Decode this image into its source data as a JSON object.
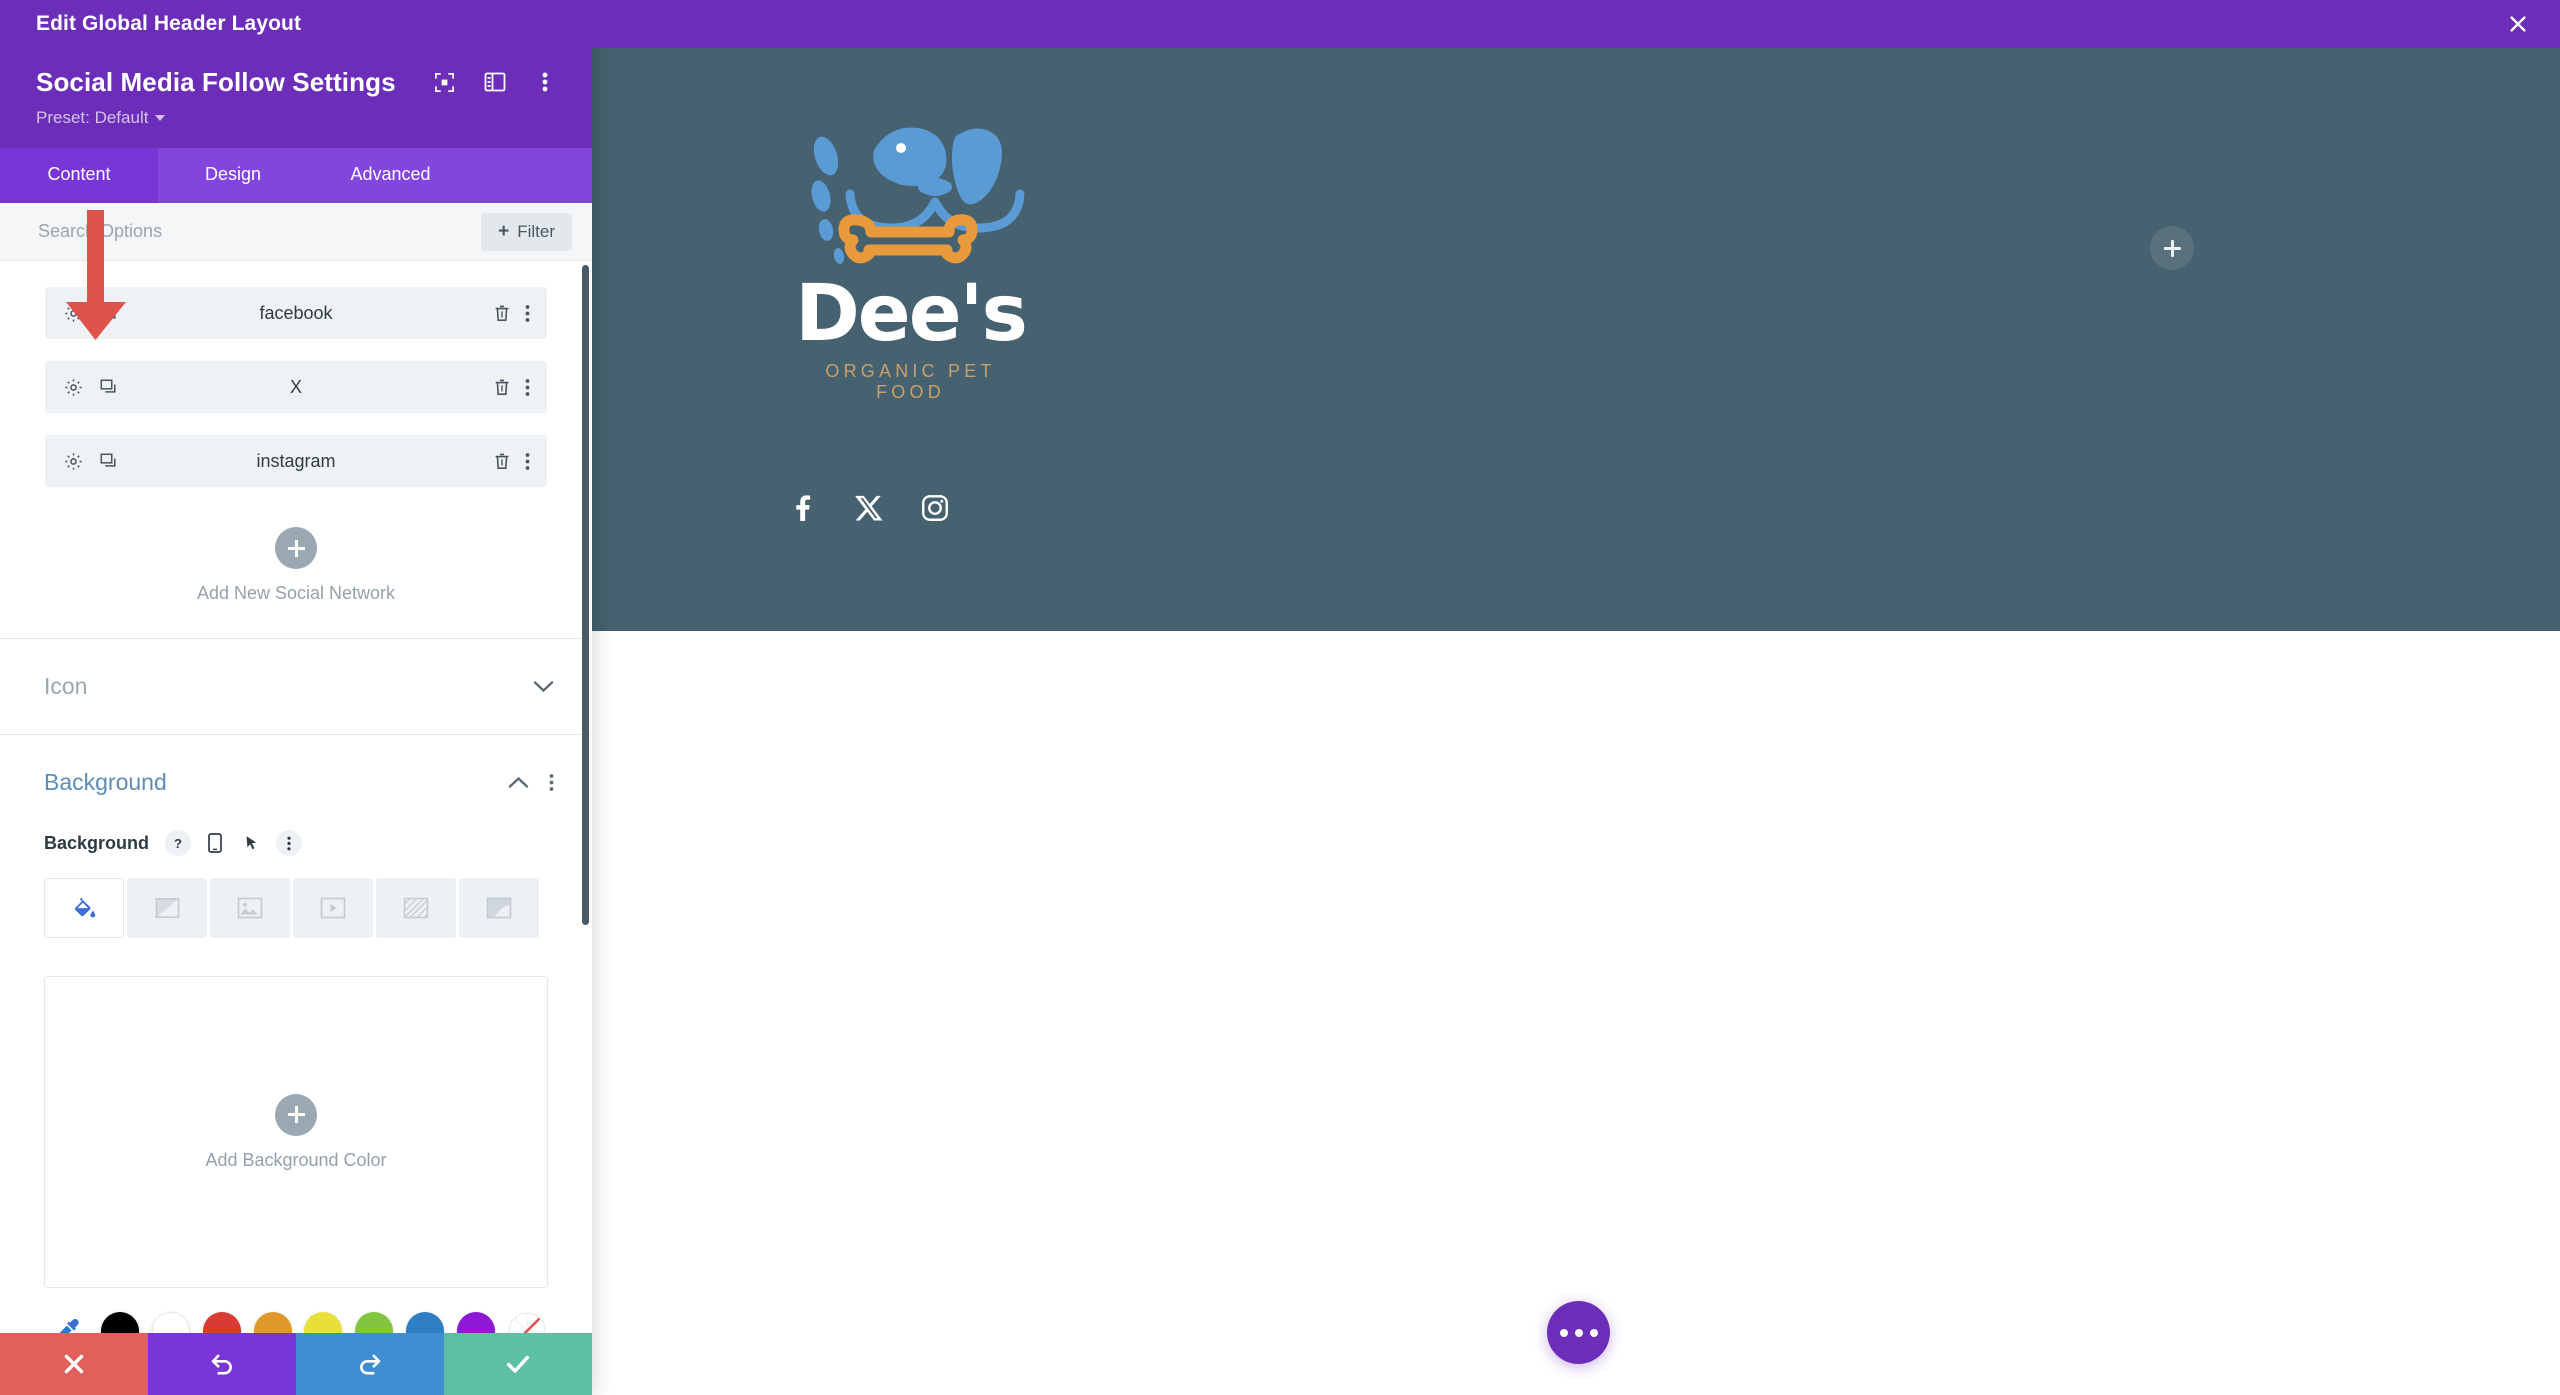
{
  "titlebar": {
    "text": "Edit Global Header Layout",
    "close_icon": "close-icon"
  },
  "panel_header": {
    "title": "Social Media Follow Settings",
    "preset_label": "Preset: Default",
    "icons": [
      "focus-mode-icon",
      "panel-layout-icon",
      "kebab-menu-icon"
    ]
  },
  "tabs": [
    {
      "label": "Content",
      "active": true
    },
    {
      "label": "Design",
      "active": false
    },
    {
      "label": "Advanced",
      "active": false
    }
  ],
  "search": {
    "placeholder": "Search Options",
    "value": "",
    "filter_label": "Filter",
    "filter_plus": "+"
  },
  "social_networks": {
    "items": [
      {
        "name": "facebook"
      },
      {
        "name": "X"
      },
      {
        "name": "instagram"
      }
    ],
    "row_icons": [
      "gear-icon",
      "duplicate-icon",
      "trash-icon",
      "kebab-menu-icon"
    ],
    "add_label": "Add New Social Network"
  },
  "sections": [
    {
      "title": "Icon",
      "open": false
    },
    {
      "title": "Background",
      "open": true
    }
  ],
  "background": {
    "label": "Background",
    "label_icons": [
      "help-icon",
      "responsive-mobile-icon",
      "hover-cursor-icon",
      "kebab-menu-icon"
    ],
    "types": [
      {
        "name": "background-color-tab",
        "active": true
      },
      {
        "name": "background-gradient-tab",
        "active": false
      },
      {
        "name": "background-image-tab",
        "active": false
      },
      {
        "name": "background-video-tab",
        "active": false
      },
      {
        "name": "background-pattern-tab",
        "active": false
      },
      {
        "name": "background-mask-tab",
        "active": false
      }
    ],
    "add_color_label": "Add Background Color",
    "swatches": [
      {
        "name": "eyedropper",
        "color": "#3b6fd4"
      },
      {
        "name": "black",
        "color": "#000000"
      },
      {
        "name": "white",
        "color": "#ffffff"
      },
      {
        "name": "red",
        "color": "#d93a34"
      },
      {
        "name": "orange",
        "color": "#e0982a"
      },
      {
        "name": "yellow",
        "color": "#e8e03a"
      },
      {
        "name": "green",
        "color": "#82c53f"
      },
      {
        "name": "blue",
        "color": "#2f7fc4"
      },
      {
        "name": "purple",
        "color": "#8d19d6"
      },
      {
        "name": "transparent",
        "color": "#ffffff"
      }
    ]
  },
  "bottom_bar": [
    {
      "name": "cancel-button",
      "icon": "close-icon",
      "color": "#e0605c"
    },
    {
      "name": "undo-button",
      "icon": "undo-icon",
      "color": "#7a35d6"
    },
    {
      "name": "redo-button",
      "icon": "redo-icon",
      "color": "#3f8ed4"
    },
    {
      "name": "save-button",
      "icon": "check-icon",
      "color": "#5dbfa4"
    }
  ],
  "preview": {
    "hero_bg": "#46616f",
    "logo": {
      "wordmark": "Dee's",
      "tagline": "ORGANIC PET FOOD",
      "mark_blue": "#5b9bd5",
      "mark_orange": "#e89a3c",
      "tagline_color": "#c8a06a"
    },
    "social_icons": [
      "facebook-icon",
      "x-icon",
      "instagram-icon"
    ],
    "add_column_buttons": [
      "add-column-button",
      "add-column-button"
    ],
    "fab": {
      "name": "builder-menu-fab",
      "color": "#6c2eb9"
    }
  },
  "annotation": {
    "arrow": "red-down-arrow",
    "color": "#e0534d"
  }
}
